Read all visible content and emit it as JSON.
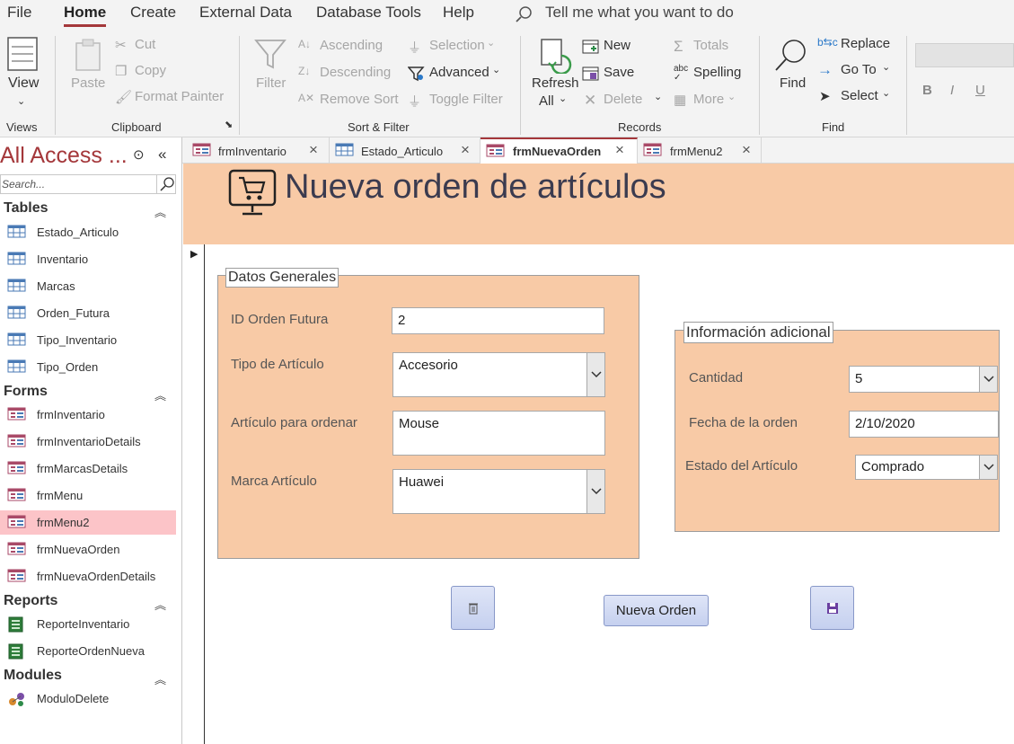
{
  "menu": {
    "file": "File",
    "home": "Home",
    "create": "Create",
    "external": "External Data",
    "dbtools": "Database Tools",
    "help": "Help",
    "tellme": "Tell me what you want to do"
  },
  "ribbon": {
    "view": "View",
    "paste": "Paste",
    "cut": "Cut",
    "copy": "Copy",
    "format_painter": "Format Painter",
    "filter": "Filter",
    "ascending": "Ascending",
    "descending": "Descending",
    "remove_sort": "Remove Sort",
    "selection": "Selection",
    "advanced": "Advanced",
    "toggle_filter": "Toggle Filter",
    "refresh": "Refresh",
    "refresh_all": "All",
    "new": "New",
    "save": "Save",
    "delete": "Delete",
    "totals": "Totals",
    "spelling": "Spelling",
    "more": "More",
    "find": "Find",
    "replace": "Replace",
    "goto": "Go To",
    "select": "Select",
    "bold": "B",
    "italic": "I",
    "underline": "U",
    "groups": {
      "views": "Views",
      "clipboard": "Clipboard",
      "sort_filter": "Sort & Filter",
      "records": "Records",
      "find": "Find"
    }
  },
  "nav": {
    "title": "All Access ...",
    "search_placeholder": "Search...",
    "sections": {
      "tables": "Tables",
      "forms": "Forms",
      "reports": "Reports",
      "modules": "Modules"
    },
    "tables": [
      "Estado_Articulo",
      "Inventario",
      "Marcas",
      "Orden_Futura",
      "Tipo_Inventario",
      "Tipo_Orden"
    ],
    "forms": [
      "frmInventario",
      "frmInventarioDetails",
      "frmMarcasDetails",
      "frmMenu",
      "frmMenu2",
      "frmNuevaOrden",
      "frmNuevaOrdenDetails"
    ],
    "reports": [
      "ReporteInventario",
      "ReporteOrdenNueva"
    ],
    "modules": [
      "ModuloDelete"
    ]
  },
  "tabs": [
    "frmInventario",
    "Estado_Articulo",
    "frmNuevaOrden",
    "frmMenu2"
  ],
  "form": {
    "title": "Nueva orden de artículos",
    "general": {
      "title": "Datos Generales",
      "id_label": "ID Orden Futura",
      "id_value": "2",
      "tipo_label": "Tipo de Artículo",
      "tipo_value": "Accesorio",
      "articulo_label": "Artículo para ordenar",
      "articulo_value": "Mouse",
      "marca_label": "Marca Artículo",
      "marca_value": "Huawei"
    },
    "extra": {
      "title": "Información adicional",
      "cantidad_label": "Cantidad",
      "cantidad_value": "5",
      "fecha_label": "Fecha de la orden",
      "fecha_value": "2/10/2020",
      "estado_label": "Estado del Artículo",
      "estado_value": "Comprado"
    },
    "new_order_button": "Nueva Orden"
  },
  "colors": {
    "accent": "#a4373a",
    "form_peach": "#f8caa6",
    "selected_nav": "#fcc4c8"
  }
}
